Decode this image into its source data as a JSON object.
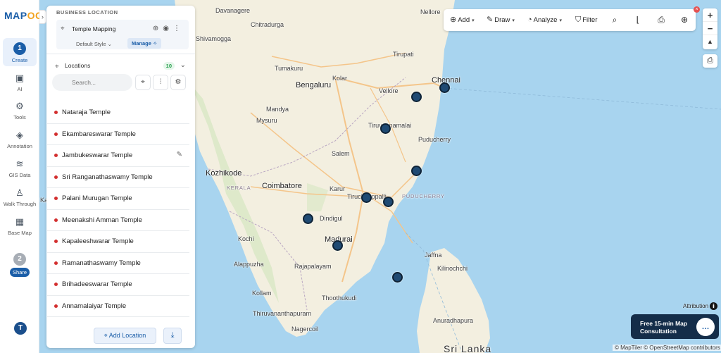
{
  "app": {
    "logo_main": "MAP",
    "logo_accent": "OG"
  },
  "rail": {
    "create_step": "1",
    "create_label": "Create",
    "ai_label": "AI",
    "tools_label": "Tools",
    "annotation_label": "Annotation",
    "gis_label": "GIS Data",
    "walk_label": "Walk Through",
    "basemap_label": "Base Map",
    "share_step": "2",
    "share_label": "Share",
    "avatar_initial": "T"
  },
  "panel": {
    "section_title": "BUSINESS LOCATION",
    "project_name": "Temple Mapping",
    "style_label": "Default Style",
    "manage_label": "Manage",
    "locations_label": "Locations",
    "locations_count": "10",
    "search_placeholder": "Search...",
    "temples": [
      "Nataraja Temple",
      "Ekambareswarar Temple",
      "Jambukeswarar Temple",
      "Sri Ranganathaswamy Temple",
      "Palani Murugan Temple",
      "Meenakshi Amman Temple",
      "Kapaleeshwarar Temple",
      "Ramanathaswamy Temple",
      "Brihadeeswarar Temple",
      "Annamalaiyar Temple"
    ],
    "add_location_label": "Add Location"
  },
  "toolbar": {
    "add_label": "Add",
    "draw_label": "Draw",
    "analyze_label": "Analyze",
    "filter_label": "Filter"
  },
  "map_labels": {
    "davanagere": "Davanagere",
    "nellore": "Nellore",
    "chitradurga": "Chitradurga",
    "shivamogga": "Shivamogga",
    "tirupati": "Tirupati",
    "tumakuru": "Tumakuru",
    "kolar": "Kolar",
    "chennai": "Chennai",
    "bengaluru": "Bengaluru",
    "vellore": "Vellore",
    "mandya": "Mandya",
    "mysuru": "Mysuru",
    "tiruvannamalai": "Tiruvannamalai",
    "puducherry": "Puducherry",
    "salem": "Salem",
    "kozhikode": "Kozhikode",
    "kerala": "KERALA",
    "coimbatore": "Coimbatore",
    "karur": "Karur",
    "tiruchirappalli": "Tiruchirappalli",
    "puducherry_state": "PUDUCHERRY",
    "dindigul": "Dindigul",
    "kochi": "Kochi",
    "madurai": "Madurai",
    "jaffna": "Jaffna",
    "alappuzha": "Alappuzha",
    "rajapalayam": "Rajapalayam",
    "kilinochchi": "Kilinochchi",
    "kollam": "Kollam",
    "thoothukudi": "Thoothukudi",
    "thiruvananthapuram": "Thiruvananthapuram",
    "anuradhapura": "Anuradhapura",
    "nagercoil": "Nagercoil",
    "sri_lanka": "Sri Lanka",
    "edge_label": "Ka"
  },
  "attribution": {
    "label": "Attribution",
    "copyright": "© MapTiler © OpenStreetMap contributors"
  },
  "consult": {
    "line1": "Free 15-min Map",
    "line2": "Consultation"
  },
  "colors": {
    "brand": "#1b5ea8",
    "accent": "#f2a21c",
    "marker": "#1f4a73",
    "water": "#a8d4ef",
    "land": "#f3efe0"
  }
}
